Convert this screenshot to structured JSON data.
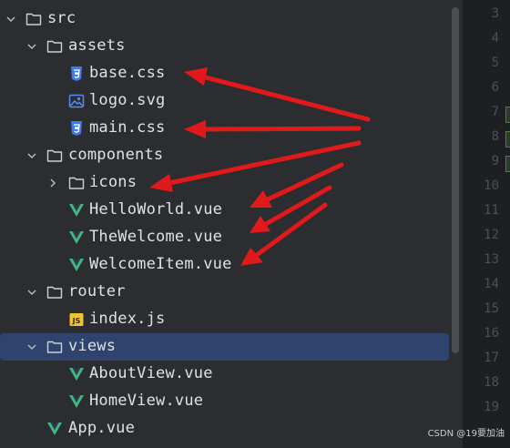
{
  "tree": {
    "src": "src",
    "assets": "assets",
    "base_css": "base.css",
    "logo_svg": "logo.svg",
    "main_css": "main.css",
    "components": "components",
    "icons": "icons",
    "hello_world": "HelloWorld.vue",
    "the_welcome": "TheWelcome.vue",
    "welcome_item": "WelcomeItem.vue",
    "router": "router",
    "index_js": "index.js",
    "views": "views",
    "about_view": "AboutView.vue",
    "home_view": "HomeView.vue",
    "app_vue": "App.vue"
  },
  "icons": {
    "folder": "folder-icon",
    "css": "css-file-icon",
    "image": "image-file-icon",
    "vue": "vue-file-icon",
    "js": "js-file-icon",
    "chevron_down": "chevron-down-icon",
    "chevron_right": "chevron-right-icon",
    "js_badge": "JS"
  },
  "gutter": {
    "lines": [
      "3",
      "4",
      "5",
      "6",
      "7",
      "8",
      "9",
      "10",
      "11",
      "12",
      "13",
      "14",
      "15",
      "16",
      "17",
      "18",
      "19"
    ]
  },
  "colors": {
    "selection": "#2e436e",
    "arrow": "#e0191b",
    "vue_green": "#41b883",
    "css_blue": "#3d7bf0",
    "js_yellow": "#f1c232"
  },
  "watermark": "CSDN @19要加油"
}
